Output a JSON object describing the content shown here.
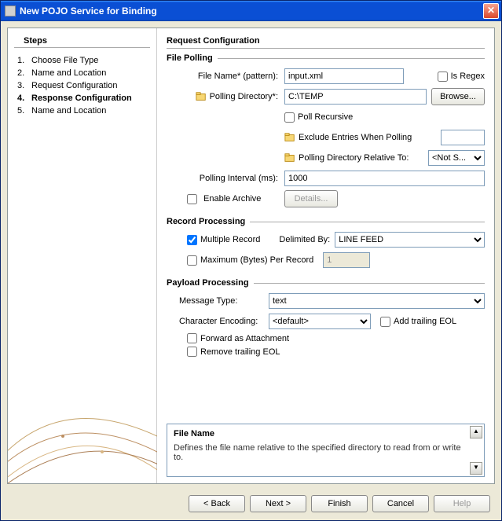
{
  "window": {
    "title": "New POJO Service for Binding"
  },
  "steps": {
    "title": "Steps",
    "items": [
      {
        "num": "1.",
        "label": "Choose File Type"
      },
      {
        "num": "2.",
        "label": "Name and Location"
      },
      {
        "num": "3.",
        "label": "Request Configuration"
      },
      {
        "num": "4.",
        "label": "Response Configuration",
        "current": true
      },
      {
        "num": "5.",
        "label": "Name and Location"
      }
    ]
  },
  "main": {
    "title": "Request Configuration",
    "filePolling": {
      "groupTitle": "File Polling",
      "fileNameLabel": "File Name* (pattern):",
      "fileNameValue": "input.xml",
      "isRegexLabel": "Is Regex",
      "pollingDirLabel": "Polling Directory*:",
      "pollingDirValue": "C:\\TEMP",
      "browseLabel": "Browse...",
      "pollRecursiveLabel": "Poll Recursive",
      "excludeLabel": "Exclude Entries When Polling",
      "relativeToLabel": "Polling Directory Relative To:",
      "relativeToValue": "<Not S...",
      "intervalLabel": "Polling Interval (ms):",
      "intervalValue": "1000",
      "enableArchiveLabel": "Enable Archive",
      "detailsLabel": "Details..."
    },
    "recordProcessing": {
      "groupTitle": "Record Processing",
      "multipleRecordLabel": "Multiple Record",
      "delimitedByLabel": "Delimited By:",
      "delimitedByValue": "LINE FEED",
      "maxBytesLabel": "Maximum (Bytes) Per Record",
      "maxBytesValue": "1"
    },
    "payloadProcessing": {
      "groupTitle": "Payload Processing",
      "messageTypeLabel": "Message Type:",
      "messageTypeValue": "text",
      "charEncodingLabel": "Character Encoding:",
      "charEncodingValue": "<default>",
      "addTrailingEolLabel": "Add trailing EOL",
      "forwardAttachmentLabel": "Forward as Attachment",
      "removeTrailingEolLabel": "Remove trailing EOL"
    },
    "description": {
      "title": "File Name",
      "text": "Defines the file name relative to the specified directory to read from or write to."
    }
  },
  "footer": {
    "back": "< Back",
    "next": "Next >",
    "finish": "Finish",
    "cancel": "Cancel",
    "help": "Help"
  }
}
